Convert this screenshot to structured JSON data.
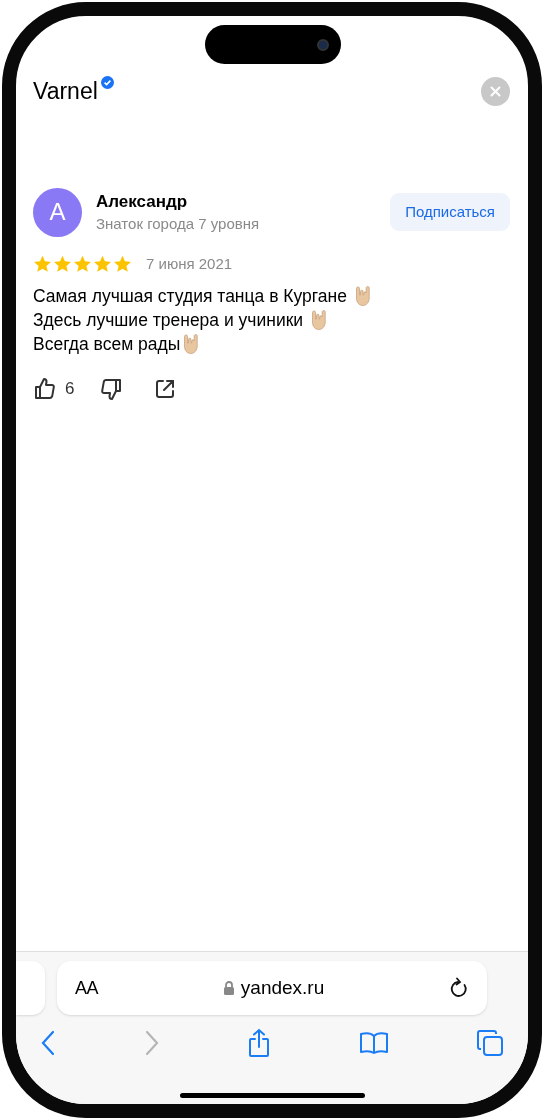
{
  "page": {
    "title": "Varnel",
    "verified": true
  },
  "review": {
    "author": {
      "initial": "А",
      "name": "Александр",
      "level": "Знаток города 7 уровня"
    },
    "subscribe_button": "Подписаться",
    "stars": 5,
    "date": "7 июня 2021",
    "lines": [
      {
        "text": "Самая лучшая студия танца в Кургане ",
        "emoji": true
      },
      {
        "text": "Здесь лучшие тренера и учиники ",
        "emoji": true
      },
      {
        "text": "Всегда всем рады",
        "emoji": true
      }
    ],
    "likes": "6"
  },
  "browser": {
    "text_size": "AA",
    "url": "yandex.ru",
    "back_disabled": false,
    "forward_disabled": true
  }
}
